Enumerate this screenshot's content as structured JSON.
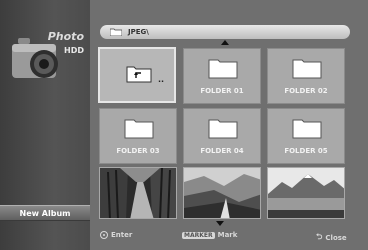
{
  "sidebar": {
    "title": "Photo",
    "subtitle": "HDD",
    "new_album_label": "New Album"
  },
  "path": {
    "text": "JPEG\\"
  },
  "tiles": {
    "up": {
      "dots": ".."
    },
    "folders": [
      "FOLDER 01",
      "FOLDER 02",
      "FOLDER 03",
      "FOLDER 04",
      "FOLDER 05"
    ]
  },
  "footer": {
    "enter_label": "Enter",
    "marker_key": "MARKER",
    "mark_label": "Mark",
    "close_label": "Close"
  },
  "colors": {
    "background": "#6f6f6f",
    "tile": "#a9a9a9",
    "sidebar": "#4b4b4b"
  }
}
